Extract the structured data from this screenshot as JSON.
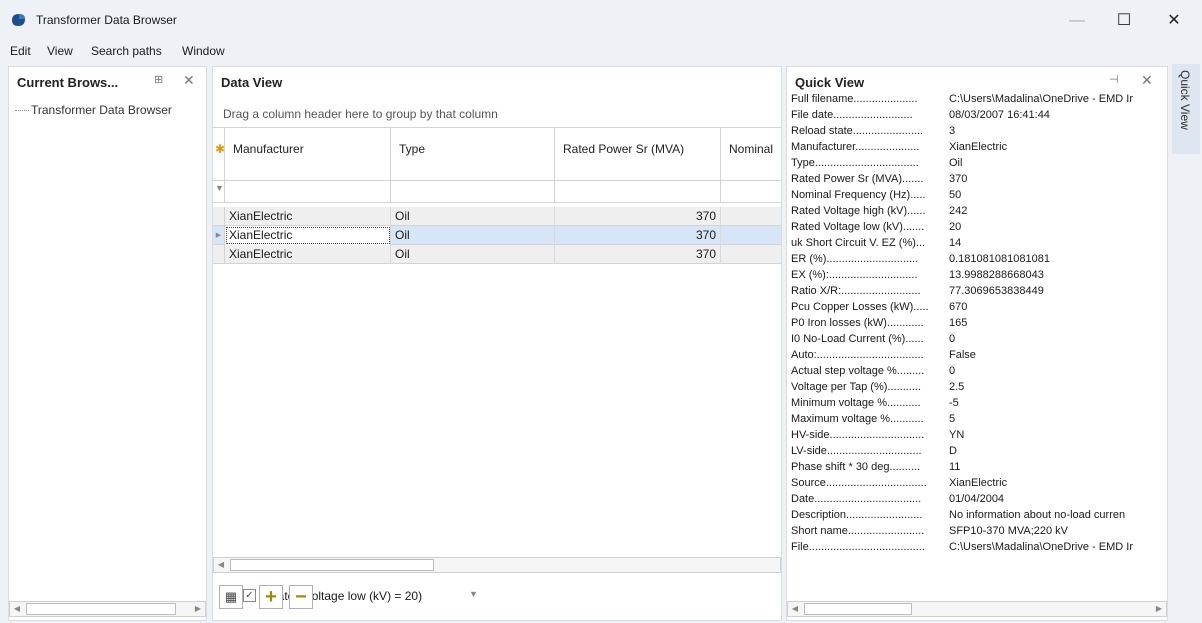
{
  "window": {
    "title": "Transformer Data Browser",
    "min": "—",
    "max": "☐",
    "close": "✕"
  },
  "menu": [
    "Edit",
    "View",
    "Search paths",
    "Window"
  ],
  "browser": {
    "title": "Current Brows...",
    "pin": "⊞",
    "close": "✕",
    "tree_item": "Transformer Data Browser"
  },
  "dataview": {
    "title": "Data View",
    "group_hint": "Drag a column header here to group by that column",
    "columns": [
      "Manufacturer",
      "Type",
      "Rated Power Sr (MVA)",
      "Nominal"
    ],
    "rows": [
      [
        "XianElectric",
        "Oil",
        "370"
      ],
      [
        "XianElectric",
        "Oil",
        "370"
      ],
      [
        "XianElectric",
        "Oil",
        "370"
      ]
    ],
    "selected_row": 1,
    "filter_text": "(Rated Voltage low (kV) = 20)",
    "filter_close": "✕",
    "filter_check": "✓"
  },
  "quickview": {
    "title": "Quick View",
    "pin": "⊣",
    "close": "✕",
    "side_tab": "Quick View",
    "rows": [
      [
        "Full filename.....................",
        "C:\\Users\\Madalina\\OneDrive - EMD Ir"
      ],
      [
        "File date..........................",
        "08/03/2007 16:41:44"
      ],
      [
        "Reload state.......................",
        "3"
      ],
      [
        "Manufacturer.....................",
        "XianElectric"
      ],
      [
        "Type..................................",
        "Oil"
      ],
      [
        "Rated Power Sr (MVA).......",
        "370"
      ],
      [
        "Nominal Frequency (Hz).....",
        "50"
      ],
      [
        "Rated Voltage high (kV)......",
        "242"
      ],
      [
        "Rated Voltage low (kV).......",
        "20"
      ],
      [
        "uk Short Circuit V. EZ (%)...",
        "14"
      ],
      [
        "ER (%)..............................",
        "0.181081081081081"
      ],
      [
        "EX (%):.............................",
        "13.9988288668043"
      ],
      [
        "Ratio X/R:..........................",
        "77.3069653838449"
      ],
      [
        "Pcu Copper Losses (kW).....",
        "670"
      ],
      [
        "P0 Iron losses (kW)............",
        "165"
      ],
      [
        "I0 No-Load Current (%)......",
        "0"
      ],
      [
        "Auto:...................................",
        "False"
      ],
      [
        "Actual step voltage %.........",
        "0"
      ],
      [
        "Voltage per Tap (%)...........",
        "2.5"
      ],
      [
        "Minimum voltage %...........",
        "-5"
      ],
      [
        "Maximum voltage %...........",
        "5"
      ],
      [
        "HV-side...............................",
        "YN"
      ],
      [
        "LV-side...............................",
        "D"
      ],
      [
        "Phase shift * 30 deg..........",
        "11"
      ],
      [
        "Source.................................",
        "XianElectric"
      ],
      [
        "Date...................................",
        "01/04/2004"
      ],
      [
        "Description.........................",
        "No information about no-load curren"
      ],
      [
        "Short name.........................",
        "SFP10-370 MVA;220 kV"
      ],
      [
        "File......................................",
        "C:\\Users\\Madalina\\OneDrive - EMD Ir"
      ]
    ]
  }
}
